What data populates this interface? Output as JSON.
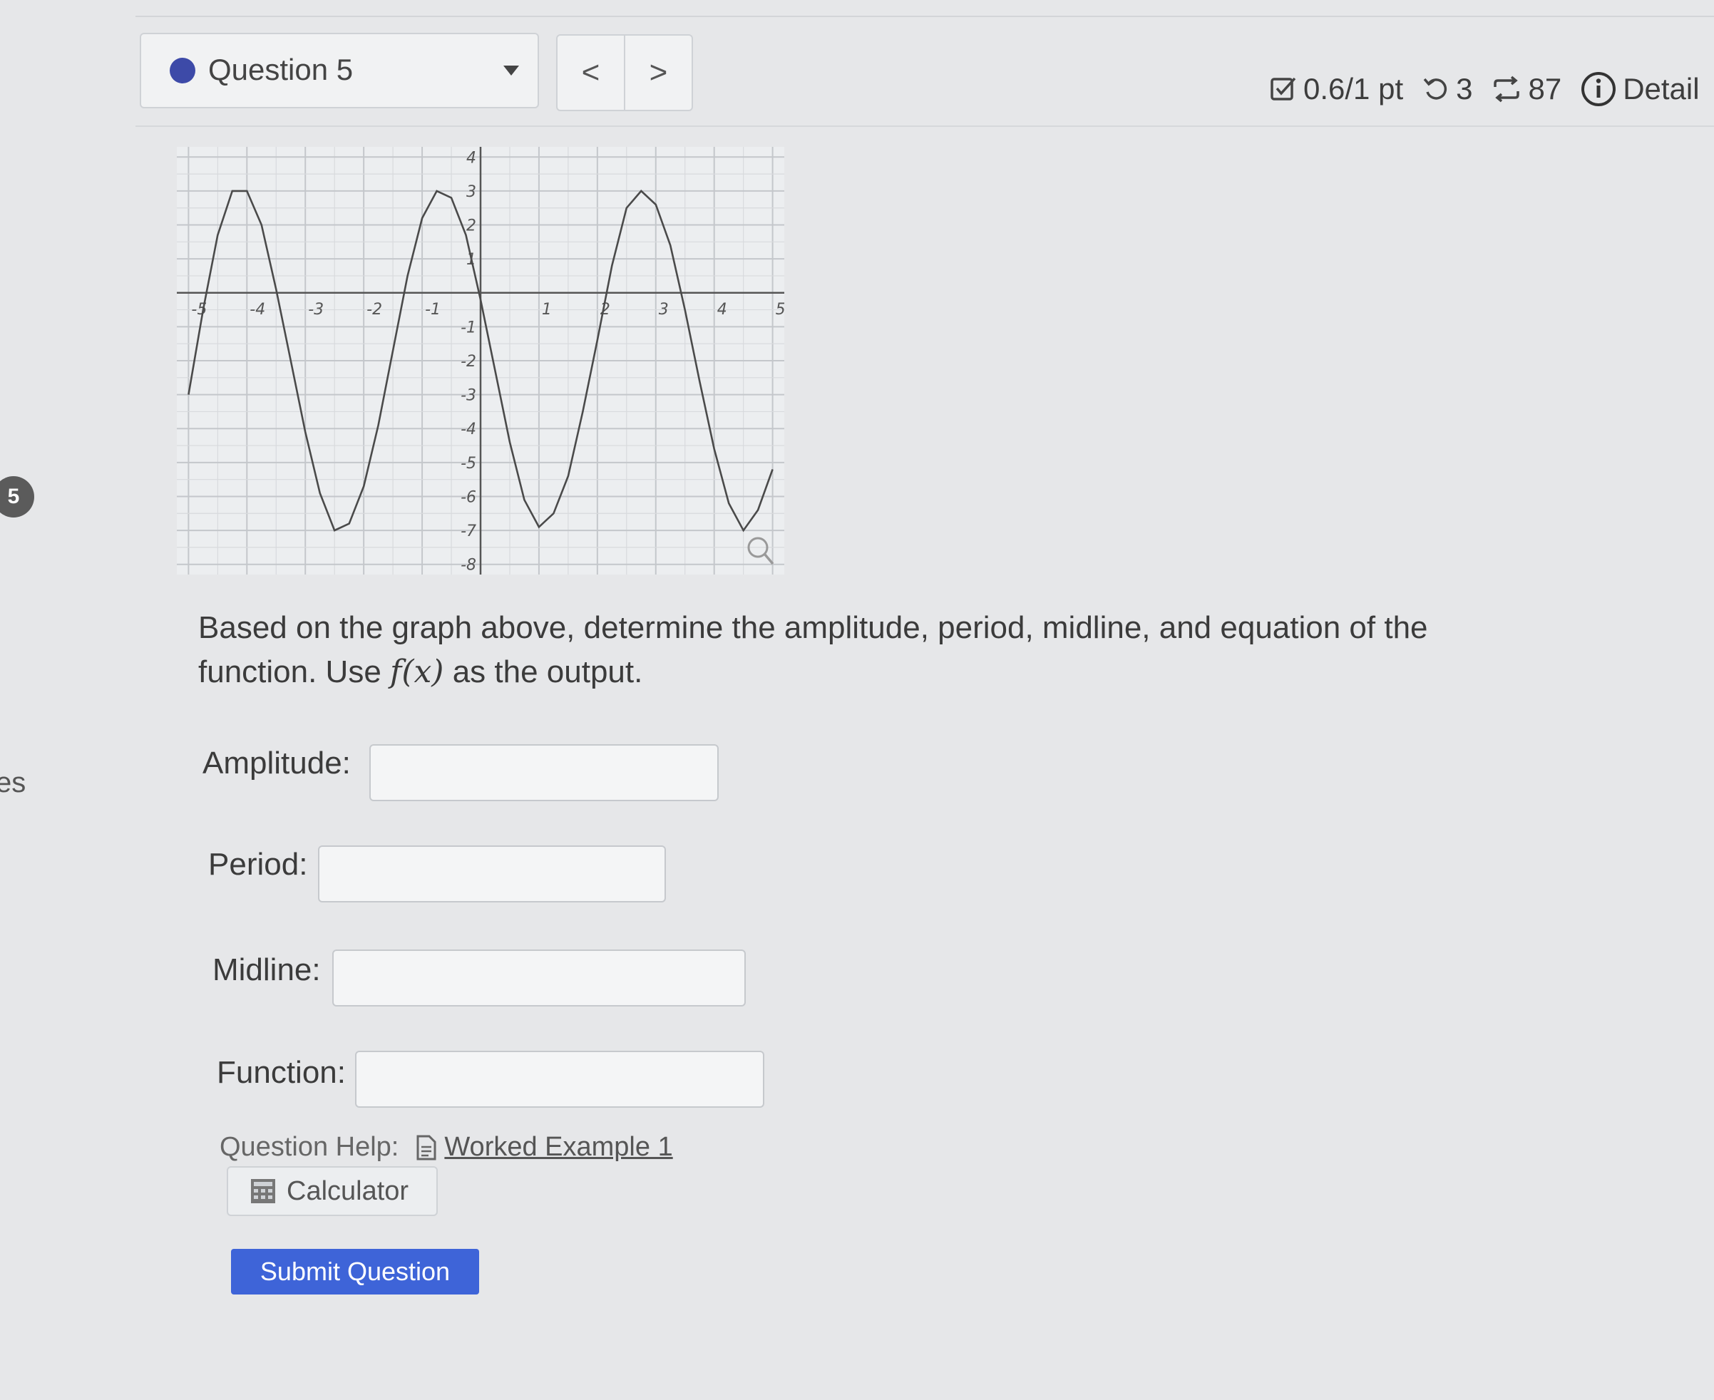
{
  "nav": {
    "question_label": "Question 5",
    "prev_symbol": "<",
    "next_symbol": ">"
  },
  "stats": {
    "score": "0.6/1 pt",
    "retries": "3",
    "attempts": "87",
    "details_label": "Detail"
  },
  "gutter": {
    "question_number": "5",
    "cut_text": "es"
  },
  "chart_data": {
    "type": "line",
    "title": "",
    "xlabel": "",
    "ylabel": "",
    "xlim": [
      -5.2,
      5.2
    ],
    "ylim": [
      -8.3,
      4.3
    ],
    "x_ticks": [
      "-5",
      "-4",
      "-3",
      "-2",
      "-1",
      "1",
      "2",
      "3",
      "4",
      "5"
    ],
    "y_ticks": [
      "4",
      "3",
      "2",
      "1",
      "-1",
      "-2",
      "-3",
      "-4",
      "-5",
      "-6",
      "-7",
      "-8"
    ],
    "grid": true,
    "series": [
      {
        "x": [
          -5,
          -4.75,
          -4.5,
          -4.25,
          -4,
          -3.75,
          -3.5,
          -3.25,
          -3,
          -2.75,
          -2.5,
          -2.25,
          -2,
          -1.75,
          -1.5,
          -1.25,
          -1,
          -0.75,
          -0.5,
          -0.25,
          0,
          0.25,
          0.5,
          0.75,
          1,
          1.25,
          1.5,
          1.75,
          2,
          2.25,
          2.5,
          2.75,
          3,
          3.25,
          3.5,
          3.75,
          4,
          4.25,
          4.5,
          4.75,
          5
        ],
        "y": [
          -3.0,
          -0.5,
          1.7,
          3.0,
          3.0,
          2.0,
          0.1,
          -2.0,
          -4.1,
          -5.9,
          -7.0,
          -6.8,
          -5.7,
          -3.9,
          -1.7,
          0.5,
          2.2,
          3.0,
          2.8,
          1.7,
          -0.2,
          -2.3,
          -4.4,
          -6.1,
          -6.9,
          -6.5,
          -5.4,
          -3.5,
          -1.4,
          0.8,
          2.5,
          3.0,
          2.6,
          1.4,
          -0.5,
          -2.6,
          -4.6,
          -6.2,
          -7.0,
          -6.4,
          -5.2
        ]
      }
    ],
    "curve_color": "#4a4a4a"
  },
  "prompt": {
    "text_before": "Based on the graph above, determine the amplitude, period, midline, and equation of the function. Use ",
    "math": "f(x)",
    "text_after": " as the output."
  },
  "fields": {
    "amplitude_label": "Amplitude:",
    "period_label": "Period:",
    "midline_label": "Midline:",
    "function_label": "Function:"
  },
  "help": {
    "label": "Question Help:",
    "worked_example": "Worked Example 1",
    "calculator": "Calculator"
  },
  "submit_label": "Submit Question",
  "colors": {
    "accent": "#3e64d8",
    "dot": "#3d4aa8"
  }
}
